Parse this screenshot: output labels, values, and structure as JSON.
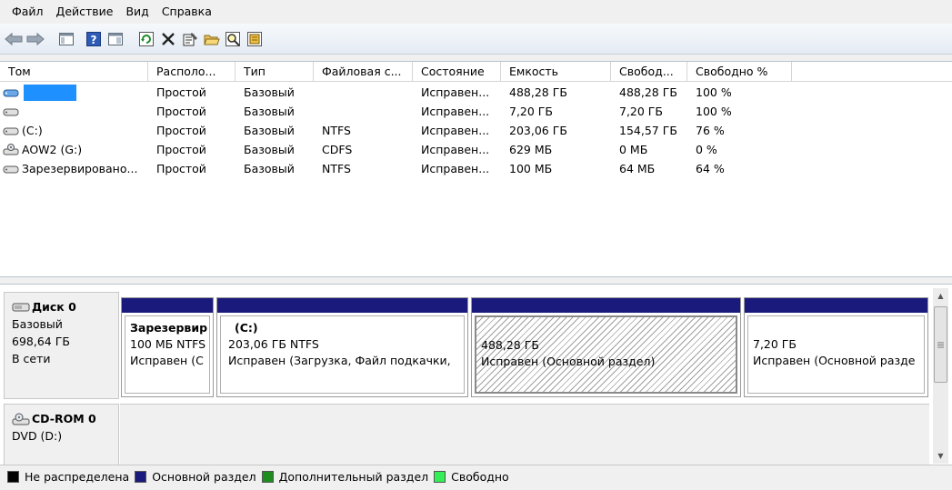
{
  "menu": [
    "Файл",
    "Действие",
    "Вид",
    "Справка"
  ],
  "toolbar_icons": [
    "back-arrow-icon",
    "forward-arrow-icon",
    "console-tree-icon",
    "help-icon",
    "view-icon",
    "refresh-icon",
    "delete-icon",
    "properties-icon",
    "open-folder-icon",
    "search-icon",
    "settings-icon"
  ],
  "columns": [
    "Том",
    "Располо...",
    "Тип",
    "Файловая с...",
    "Состояние",
    "Емкость",
    "Свобод...",
    "Свободно %"
  ],
  "volumes": [
    {
      "name": "",
      "loc": "Простой",
      "type": "Базовый",
      "fs": "",
      "state": "Исправен...",
      "cap": "488,28 ГБ",
      "free": "488,28 ГБ",
      "pct": "100 %"
    },
    {
      "name": "",
      "loc": "Простой",
      "type": "Базовый",
      "fs": "",
      "state": "Исправен...",
      "cap": "7,20 ГБ",
      "free": "7,20 ГБ",
      "pct": "100 %"
    },
    {
      "name": "(C:)",
      "loc": "Простой",
      "type": "Базовый",
      "fs": "NTFS",
      "state": "Исправен...",
      "cap": "203,06 ГБ",
      "free": "154,57 ГБ",
      "pct": "76 %"
    },
    {
      "name": "AOW2 (G:)",
      "loc": "Простой",
      "type": "Базовый",
      "fs": "CDFS",
      "state": "Исправен...",
      "cap": "629 МБ",
      "free": "0 МБ",
      "pct": "0 %"
    },
    {
      "name": "Зарезервировано...",
      "loc": "Простой",
      "type": "Базовый",
      "fs": "NTFS",
      "state": "Исправен...",
      "cap": "100 МБ",
      "free": "64 МБ",
      "pct": "64 %"
    }
  ],
  "disk0": {
    "title": "Диск 0",
    "type": "Базовый",
    "size": "698,64 ГБ",
    "status": "В сети"
  },
  "partitions": [
    {
      "title": "Зарезервир",
      "size": "100 МБ NTFS",
      "state": "Исправен (С"
    },
    {
      "title": "(C:)",
      "size": "203,06 ГБ NTFS",
      "state": "Исправен (Загрузка, Файл подкачки,"
    },
    {
      "title": "",
      "size": "488,28 ГБ",
      "state": "Исправен (Основной раздел)"
    },
    {
      "title": "",
      "size": "7,20 ГБ",
      "state": "Исправен (Основной разде"
    }
  ],
  "cdrom": {
    "title": "CD-ROM 0",
    "drive": "DVD (D:)"
  },
  "legend": [
    {
      "label": "Не распределена",
      "color": "#000000"
    },
    {
      "label": "Основной раздел",
      "color": "#1a1a7c"
    },
    {
      "label": "Дополнительный раздел",
      "color": "#1e8c1e"
    },
    {
      "label": "Свободно",
      "color": "#33ee55"
    }
  ],
  "colors": {
    "partition_bar": "#1a1a7c",
    "redaction": "#1e90ff"
  }
}
